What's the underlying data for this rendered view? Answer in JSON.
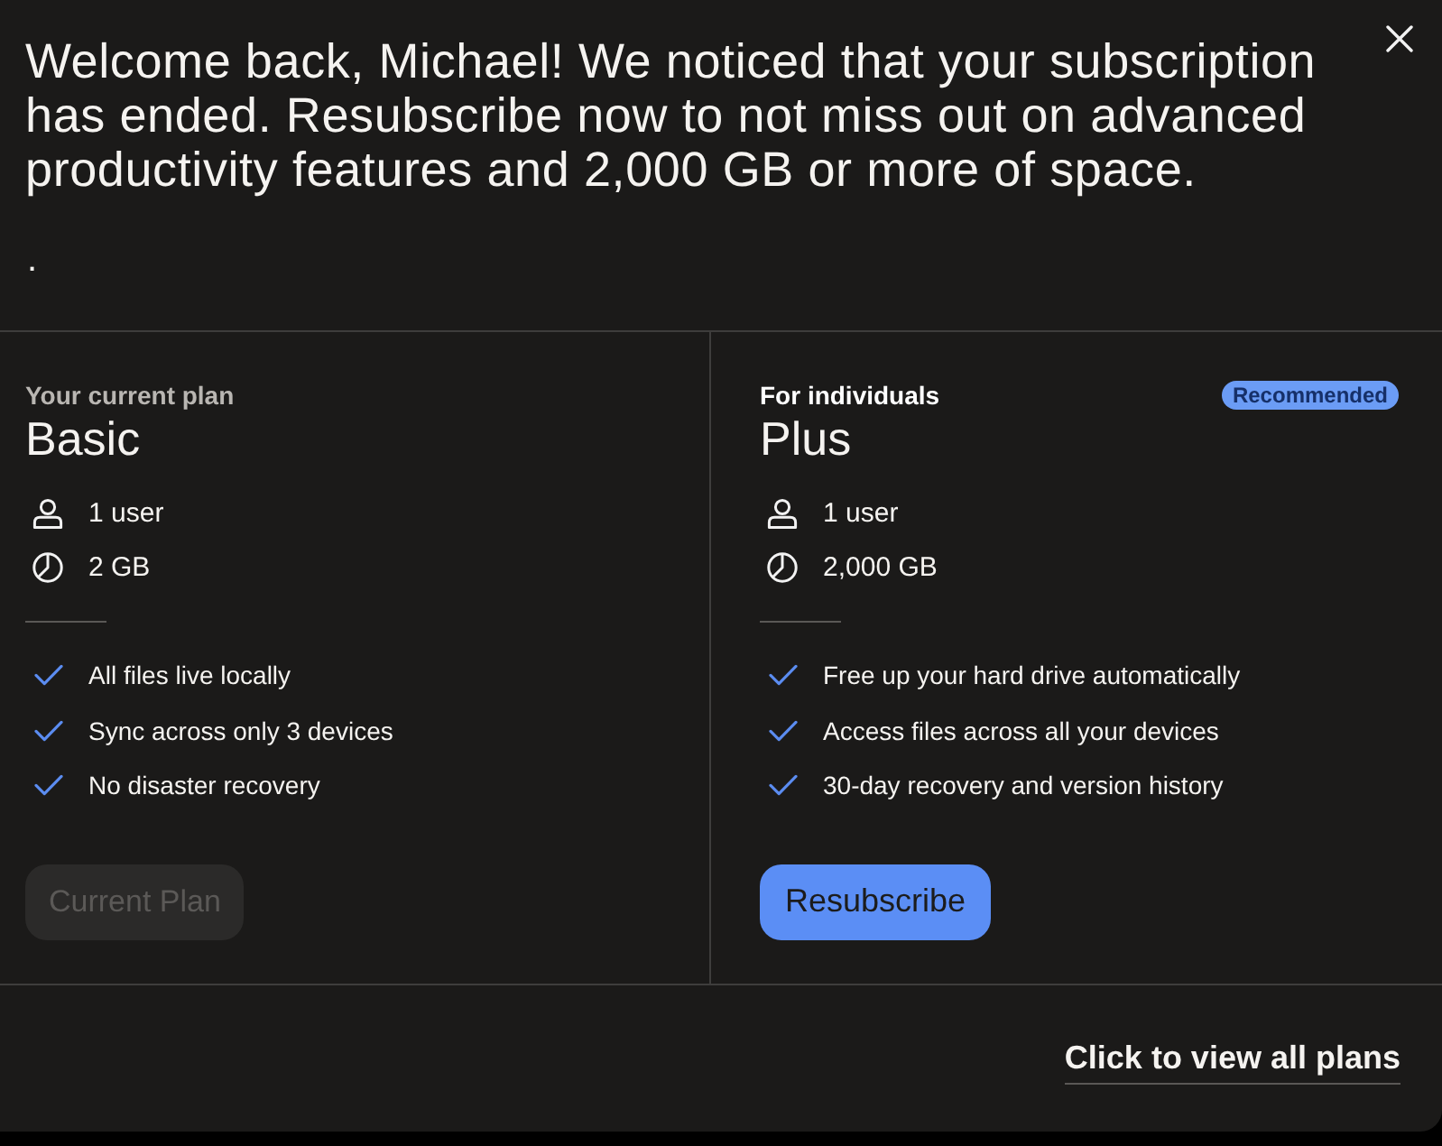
{
  "dialog": {
    "message": "Welcome back, Michael! We noticed that your subscription has ended. Resubscribe now to not miss out on advanced productivity features and 2,000 GB or more of space.",
    "note": "."
  },
  "plans": [
    {
      "current": true,
      "eyebrow": "Your current plan",
      "name": "Basic",
      "specs": [
        {
          "kind": "users",
          "text": "1 user"
        },
        {
          "kind": "storage",
          "text": "2 GB"
        }
      ],
      "features": [
        "All files live locally",
        "Sync across only 3 devices",
        "No disaster recovery"
      ],
      "button": {
        "label": "Current Plan",
        "disabled": true
      }
    },
    {
      "current": false,
      "eyebrow": "For individuals",
      "badge": "Recommended",
      "name": "Plus",
      "specs": [
        {
          "kind": "users",
          "text": "1 user"
        },
        {
          "kind": "storage",
          "text": "2,000 GB"
        }
      ],
      "features": [
        "Free up your hard drive automatically",
        "Access files across all your devices",
        "30-day recovery and version history"
      ],
      "button": {
        "label": "Resubscribe",
        "disabled": false
      }
    }
  ],
  "footer": {
    "link": "Click to view all plans"
  }
}
